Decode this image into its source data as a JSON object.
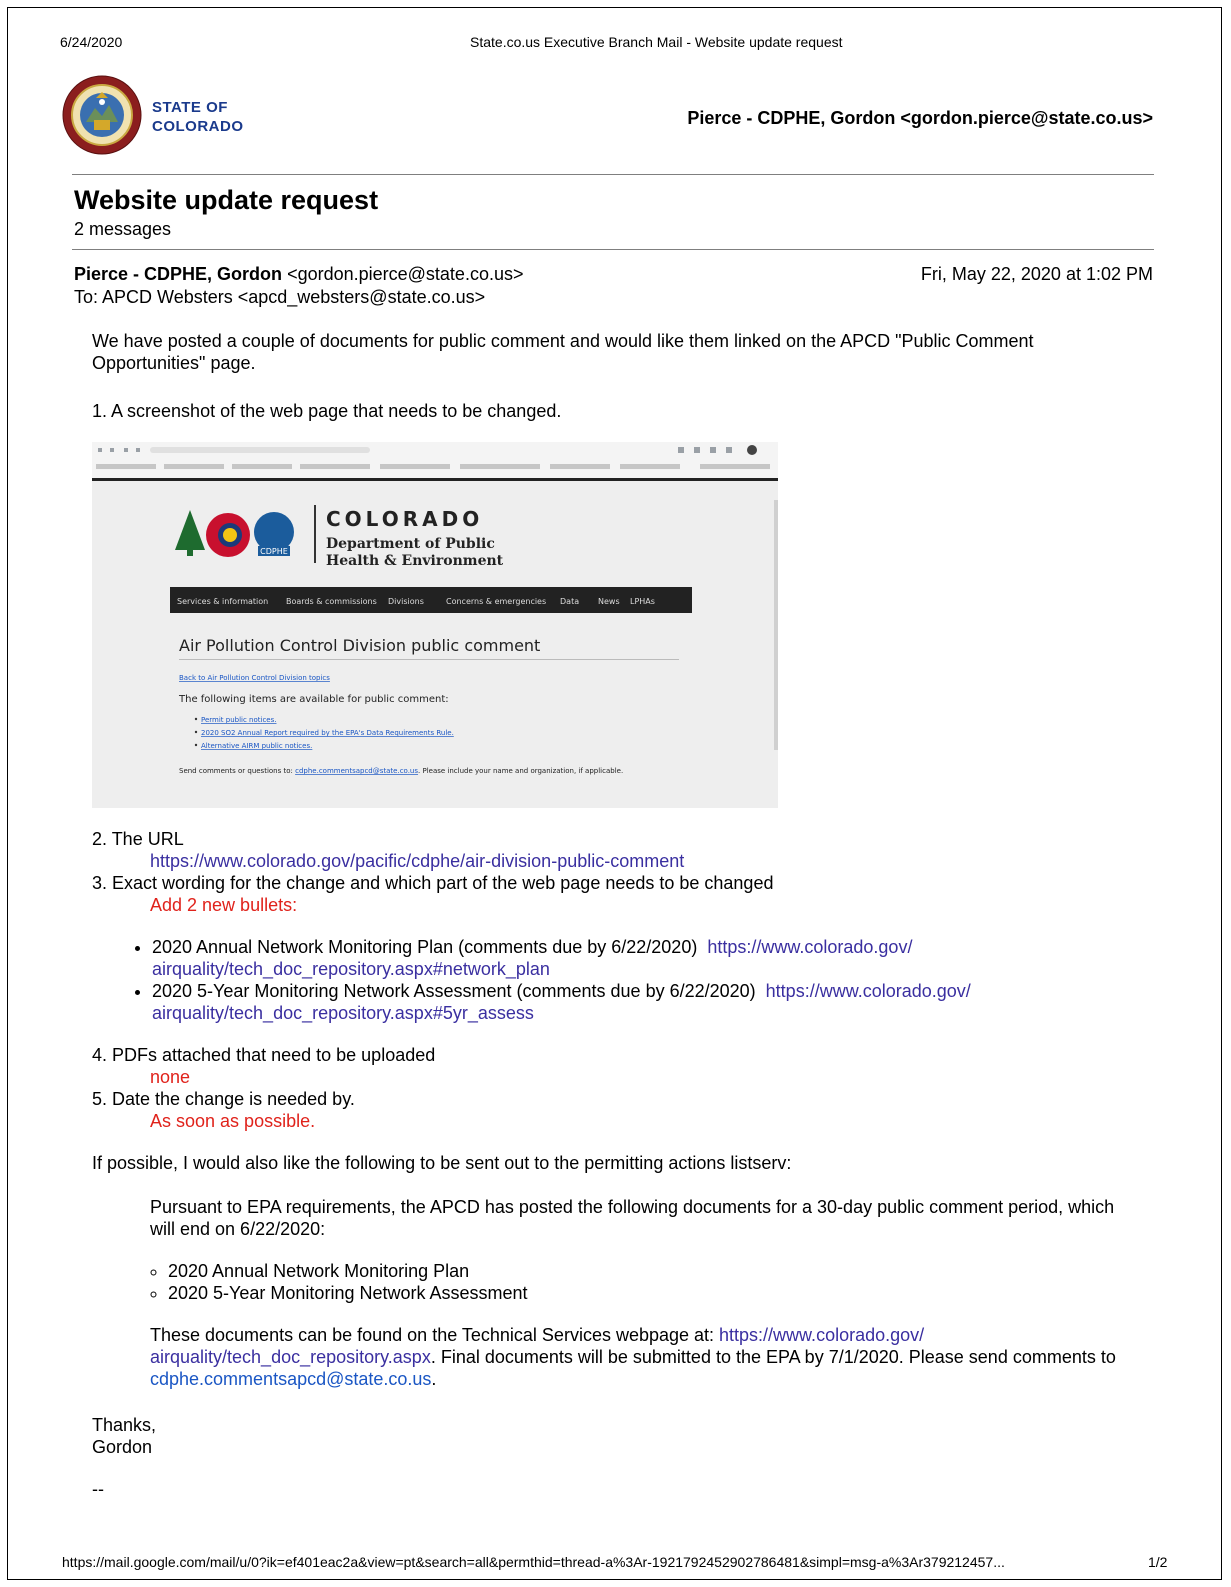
{
  "print_header": {
    "date": "6/24/2020",
    "title": "State.co.us Executive Branch Mail - Website update request"
  },
  "brand": {
    "line1": "STATE OF",
    "line2": "COLORADO"
  },
  "account": "Pierce - CDPHE, Gordon <gordon.pierce@state.co.us>",
  "thread": {
    "subject": "Website update request",
    "count": "2 messages"
  },
  "message": {
    "from_name": "Pierce - CDPHE, Gordon",
    "from_email": "<gordon.pierce@state.co.us>",
    "to": "To: APCD Websters <apcd_websters@state.co.us>",
    "date": "Fri, May 22, 2020 at 1:02 PM"
  },
  "body": {
    "intro": "We have posted a couple of documents for public comment and would like them linked on the APCD \"Public Comment Opportunities\" page.",
    "item1": "1. A screenshot of the web page that needs to be changed.",
    "item2": "2. The URL",
    "url": "https://www.colorado.gov/pacific/cdphe/air-division-public-comment",
    "item3": "3. Exact wording for the change and which part of the web page needs to be changed",
    "add_bullets": "Add 2 new bullets:",
    "bullet1_text": "2020 Annual Network Monitoring Plan (comments due by 6/22/2020)",
    "bullet1_link_a": "https://www.colorado.gov/",
    "bullet1_link_b": "airquality/tech_doc_repository.aspx#network_plan",
    "bullet2_text": "2020 5-Year Monitoring Network Assessment (comments due by 6/22/2020)",
    "bullet2_link_a": "https://www.colorado.gov/",
    "bullet2_link_b": "airquality/tech_doc_repository.aspx#5yr_assess",
    "item4": "4. PDFs attached that need to be uploaded",
    "none": "none",
    "item5": "5. Date the change is needed by.",
    "asap": "As soon as possible.",
    "listserv": "If possible, I would also like the following to be sent out to the permitting actions listserv:",
    "pursuant": "Pursuant to EPA requirements, the APCD has posted the following documents for a 30-day public comment period, which will end on 6/22/2020:",
    "doc1": "2020 Annual Network Monitoring Plan",
    "doc2": "2020 5-Year Monitoring Network Assessment",
    "found_a": "These documents can be found on the Technical Services webpage at: ",
    "found_link_a": "https://www.colorado.gov/",
    "found_link_b": "airquality/tech_doc_repository.aspx",
    "found_b": ". Final documents will be submitted to the EPA by 7/1/2020. Please send comments to ",
    "found_email": "cdphe.commentsapcd@state.co.us",
    "found_c": ".",
    "thanks": "Thanks,",
    "sig": "Gordon",
    "dash": "--"
  },
  "screenshot": {
    "brand": "COLORADO",
    "dept1": "Department of Public",
    "dept2": "Health & Environment",
    "logo_tag": "CDPHE",
    "nav": [
      "Services & information",
      "Boards & commissions",
      "Divisions",
      "Concerns & emergencies",
      "Data",
      "News",
      "LPHAs"
    ],
    "heading": "Air Pollution Control Division public comment",
    "back_link": "Back to Air Pollution Control Division topics",
    "available": "The following items are available for public comment:",
    "items": [
      "Permit public notices.",
      "2020 SO2 Annual Report required by the EPA's Data Requirements Rule.",
      "Alternative AIRM public notices."
    ],
    "send_a": "Send comments or questions to: ",
    "send_link": "cdphe.commentsapcd@state.co.us",
    "send_b": ". Please include your name and organization, if applicable."
  },
  "print_footer": {
    "url": "https://mail.google.com/mail/u/0?ik=ef401eac2a&view=pt&search=all&permthid=thread-a%3Ar-1921792452902786481&simpl=msg-a%3Ar379212457...",
    "page": "1/2"
  },
  "colors": {
    "link": "#3a2fa0",
    "red": "#e0221b",
    "navy": "#1a3a8c"
  }
}
